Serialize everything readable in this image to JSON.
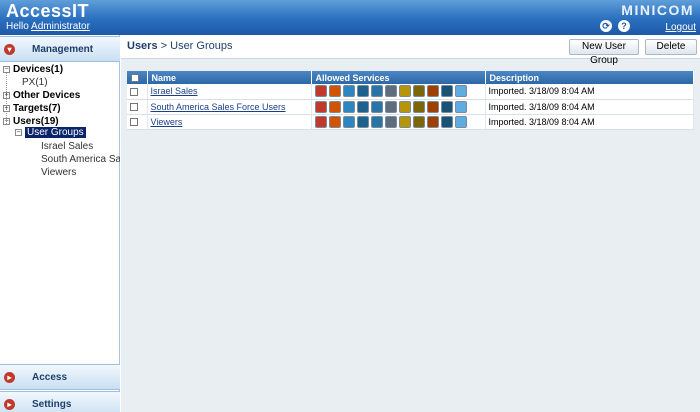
{
  "header": {
    "title": "AccessIT",
    "greeting": "Hello",
    "user": "Administrator",
    "brand": "MINICOM",
    "logout": "Logout"
  },
  "sidebar": {
    "management": "Management",
    "access": "Access",
    "settings": "Settings",
    "tree": {
      "devices": "Devices(1)",
      "px": "PX(1)",
      "other_devices": "Other Devices",
      "targets": "Targets(7)",
      "users": "Users(19)",
      "user_groups": "User Groups",
      "israel_sales": "Israel Sales",
      "south_america": "South America Sa",
      "viewers": "Viewers"
    }
  },
  "main": {
    "breadcrumb_root": "Users",
    "breadcrumb_sep": " > ",
    "breadcrumb_page": "User Groups",
    "new_button": "New User Group",
    "delete_button": "Delete",
    "columns": {
      "name": "Name",
      "services": "Allowed Services",
      "description": "Description"
    },
    "rows": [
      {
        "name": "Israel Sales",
        "description": "Imported. 3/18/09 8:04 AM"
      },
      {
        "name": "South America Sales Force Users",
        "description": "Imported. 3/18/09 8:04 AM"
      },
      {
        "name": "Viewers",
        "description": "Imported. 3/18/09 8:04 AM"
      }
    ],
    "service_icons": [
      {
        "name": "web-icon",
        "color": "#c0392b"
      },
      {
        "name": "firefox-icon",
        "color": "#d35400"
      },
      {
        "name": "ie-icon",
        "color": "#2e86c1"
      },
      {
        "name": "rdp-icon",
        "color": "#1f618d"
      },
      {
        "name": "network-icon",
        "color": "#2874a6"
      },
      {
        "name": "ssh-icon",
        "color": "#5d6d7e"
      },
      {
        "name": "vnc-icon",
        "color": "#b7950b"
      },
      {
        "name": "telnet-icon",
        "color": "#7d6608"
      },
      {
        "name": "kvm-icon",
        "color": "#a04000"
      },
      {
        "name": "power-icon",
        "color": "#1a5276"
      },
      {
        "name": "star-icon",
        "color": "#5dade2"
      }
    ]
  }
}
